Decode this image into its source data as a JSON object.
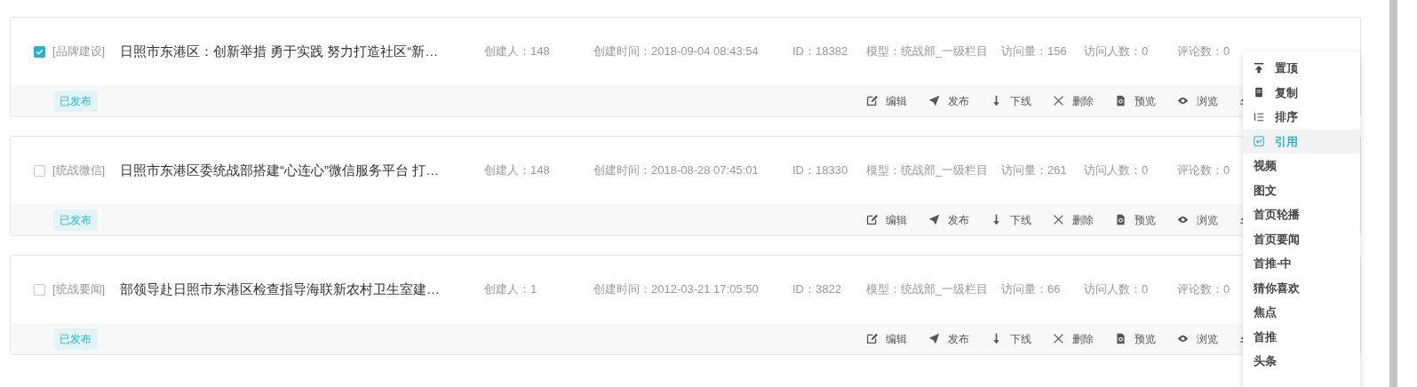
{
  "rows": [
    {
      "checked": true,
      "category": "[品牌建设]",
      "title": "日照市东港区：创新举措 勇于实践 努力打造社区“新…",
      "creator": "创建人：148",
      "created": "创建时间：2018-09-04 08:43:54",
      "id": "ID：18382",
      "model": "模型：统战部_一级栏目",
      "visits": "访问量：156",
      "visitors": "访问人数：0",
      "comments": "评论数：0",
      "status": "已发布",
      "actions": [
        "编辑",
        "发布",
        "下线",
        "删除",
        "预览",
        "浏览"
      ]
    },
    {
      "checked": false,
      "category": "[统战微信]",
      "title": "日照市东港区委统战部搭建“心连心”微信服务平台 打…",
      "creator": "创建人：148",
      "created": "创建时间：2018-08-28 07:45:01",
      "id": "ID：18330",
      "model": "模型：统战部_一级栏目",
      "visits": "访问量：261",
      "visitors": "访问人数：0",
      "comments": "评论数：0",
      "status": "已发布",
      "actions": [
        "编辑",
        "发布",
        "下线",
        "删除",
        "预览",
        "浏览"
      ]
    },
    {
      "checked": false,
      "category": "[统战要闻]",
      "title": "部领导赴日照市东港区检查指导海联新农村卫生室建…",
      "creator": "创建人：1",
      "created": "创建时间：2012-03-21 17:05:50",
      "id": "ID：3822",
      "model": "模型：统战部_一级栏目",
      "visits": "访问量：66",
      "visitors": "访问人数：0",
      "comments": "评论数：0",
      "status": "已发布",
      "actions": [
        "编辑",
        "发布",
        "下线",
        "删除",
        "预览",
        "浏览"
      ]
    }
  ],
  "menu": [
    {
      "kind": "pin",
      "label": "置顶",
      "selected": false
    },
    {
      "kind": "copy",
      "label": "复制",
      "selected": false
    },
    {
      "kind": "sort",
      "label": "排序",
      "selected": false
    },
    {
      "kind": "quote",
      "label": "引用",
      "selected": true
    },
    {
      "kind": "plain",
      "label": "视频",
      "selected": false
    },
    {
      "kind": "plain",
      "label": "图文",
      "selected": false
    },
    {
      "kind": "plain",
      "label": "首页轮播",
      "selected": false
    },
    {
      "kind": "plain",
      "label": "首页要闻",
      "selected": false
    },
    {
      "kind": "plain",
      "label": "首推-中",
      "selected": false
    },
    {
      "kind": "plain",
      "label": "猜你喜欢",
      "selected": false
    },
    {
      "kind": "plain",
      "label": "焦点",
      "selected": false
    },
    {
      "kind": "plain",
      "label": "首推",
      "selected": false
    },
    {
      "kind": "plain",
      "label": "头条",
      "selected": false
    }
  ]
}
